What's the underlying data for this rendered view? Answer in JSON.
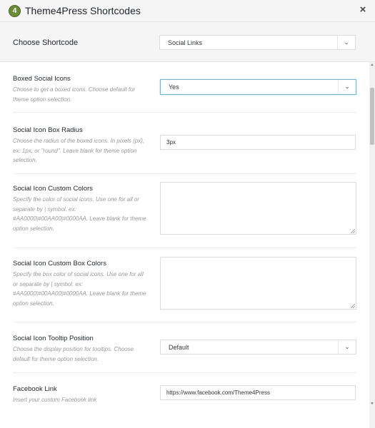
{
  "window": {
    "title": "Theme4Press Shortcodes",
    "logo_text": "4",
    "close_glyph": "×"
  },
  "choose": {
    "label": "Choose Shortcode",
    "selected": "Social Links",
    "arrow": "⌄"
  },
  "fields": {
    "boxed": {
      "title": "Boxed Social Icons",
      "desc": "Choose to get a boxed icons. Choose default for theme option selection.",
      "value": "Yes",
      "arrow": "⌄"
    },
    "radius": {
      "title": "Social Icon Box Radius",
      "desc": "Choose the radius of the boxed icons. In pixels (px), ex: 1px, or \"round\". Leave blank for theme option selection.",
      "value": "3px"
    },
    "colors": {
      "title": "Social Icon Custom Colors",
      "desc": "Specify the color of social icons. Use one for all or separate by | symbol. ex: #AA0000|#00AA00|#0000AA. Leave blank for theme option selection.",
      "value": ""
    },
    "box_colors": {
      "title": "Social Icon Custom Box Colors",
      "desc": "Specify the box color of social icons. Use one for all or separate by | symbol. ex: #AA0000|#00AA00|#0000AA. Leave blank for theme option selection.",
      "value": ""
    },
    "tooltip": {
      "title": "Social Icon Tooltip Position",
      "desc": "Choose the display position for tooltips. Choose default for theme option selection.",
      "value": "Default",
      "arrow": "⌄"
    },
    "facebook": {
      "title": "Facebook Link",
      "desc": "Insert your custom Facebook link",
      "value": "https://www.facebook.com/Theme4Press"
    }
  },
  "scrollbar": {
    "up_glyph": "▲",
    "down_glyph": "▼"
  },
  "colors": {
    "titlebar_bg": "#f5f5f5",
    "focus_border": "#7fb3c9",
    "logo_green": "#6e8a3b"
  }
}
